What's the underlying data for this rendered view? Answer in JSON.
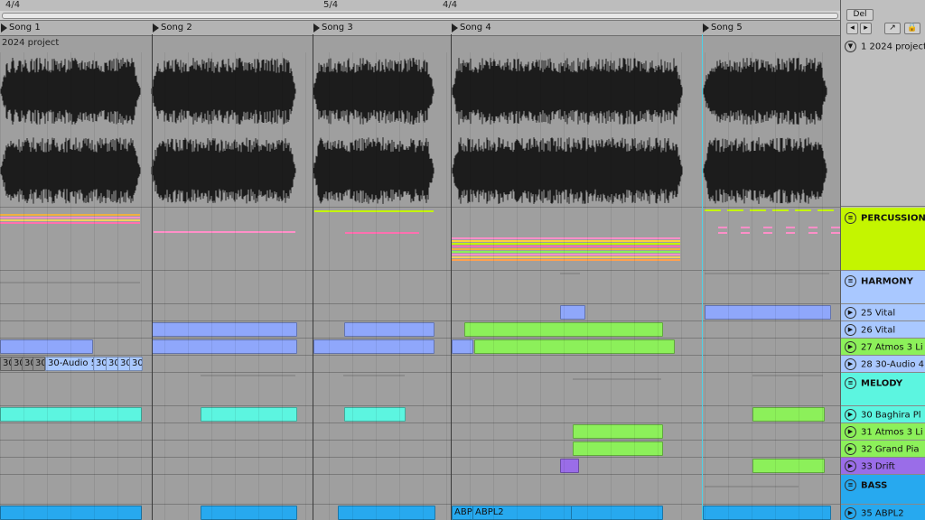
{
  "time_signatures": [
    "4/4",
    "5/4",
    "4/4"
  ],
  "locators": [
    "Song 1",
    "Song 2",
    "Song 3",
    "Song 4",
    "Song 5"
  ],
  "project_label": "2024 project",
  "header": {
    "delete_label": "Del",
    "master": "1 2024 project",
    "percussion": "PERCUSSION",
    "harmony": "HARMONY",
    "melody": "MELODY",
    "bass": "BASS",
    "tracks": [
      "25 Vital",
      "26 Vital",
      "27 Atmos 3 Li",
      "28 30-Audio 4",
      "30 Baghira Pl",
      "31 Atmos 3 Li",
      "32 Grand Pia",
      "33 Drift",
      "35 ABPL2"
    ]
  },
  "clip_names": {
    "audio_short": "30",
    "audio_long": "30-Audio 5",
    "bass_a": "ABP",
    "bass_b": "ABPL2"
  },
  "colors": {
    "blue": "#8fa7fb",
    "green": "#8cf05a",
    "cyan": "#5cf5e0",
    "sky": "#27a9ef",
    "lime": "#c4f500",
    "purple": "#9a6de8",
    "lightblue": "#a9c8ff",
    "pink": "#ff87c2"
  }
}
